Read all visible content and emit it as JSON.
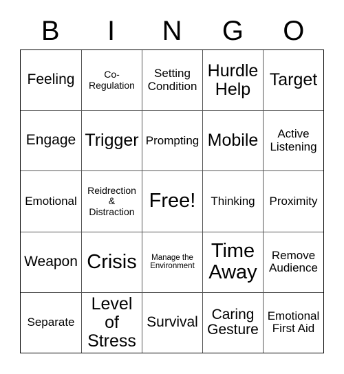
{
  "card": {
    "header_letters": [
      "B",
      "I",
      "N",
      "G",
      "O"
    ],
    "free_space": "Free!",
    "colors": {
      "background": "#ffffff",
      "text": "#000000",
      "outer_border": "#000000",
      "inner_border": "#555555"
    },
    "rows": [
      [
        {
          "label": "Feeling",
          "size": "lg"
        },
        {
          "label": "Co-\nRegulation",
          "size": "sm"
        },
        {
          "label": "Setting\nCondition",
          "size": "md"
        },
        {
          "label": "Hurdle\nHelp",
          "size": "xl"
        },
        {
          "label": "Target",
          "size": "xl"
        }
      ],
      [
        {
          "label": "Engage",
          "size": "lg"
        },
        {
          "label": "Trigger",
          "size": "xl"
        },
        {
          "label": "Prompting",
          "size": "md"
        },
        {
          "label": "Mobile",
          "size": "xl"
        },
        {
          "label": "Active\nListening",
          "size": "md"
        }
      ],
      [
        {
          "label": "Emotional",
          "size": "md"
        },
        {
          "label": "Reidrection\n&\nDistraction",
          "size": "sm"
        },
        {
          "label": "Free!",
          "size": "xxl"
        },
        {
          "label": "Thinking",
          "size": "md"
        },
        {
          "label": "Proximity",
          "size": "md"
        }
      ],
      [
        {
          "label": "Weapon",
          "size": "lg"
        },
        {
          "label": "Crisis",
          "size": "xxl"
        },
        {
          "label": "Manage the\nEnvironment",
          "size": "xs"
        },
        {
          "label": "Time\nAway",
          "size": "xxl"
        },
        {
          "label": "Remove\nAudience",
          "size": "md"
        }
      ],
      [
        {
          "label": "Separate",
          "size": "md"
        },
        {
          "label": "Level\nof\nStress",
          "size": "xl"
        },
        {
          "label": "Survival",
          "size": "lg"
        },
        {
          "label": "Caring\nGesture",
          "size": "lg"
        },
        {
          "label": "Emotional\nFirst Aid",
          "size": "md"
        }
      ]
    ]
  }
}
